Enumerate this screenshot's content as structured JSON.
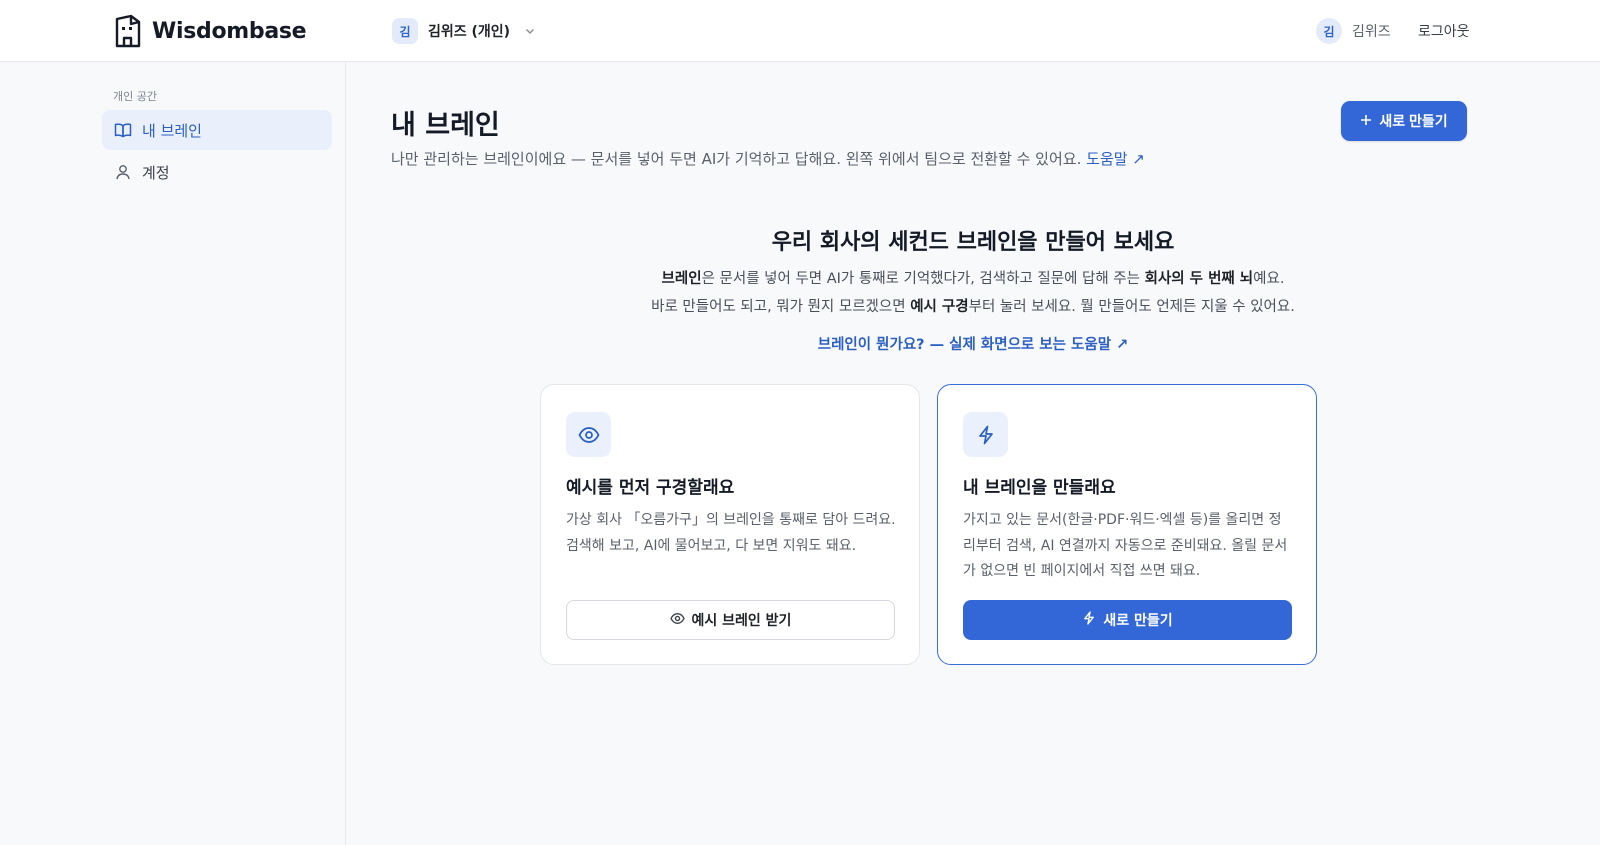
{
  "colors": {
    "accent": "#3366d6",
    "link": "#2b5fc4",
    "active_bg": "#e9effb",
    "page_bg": "#f8f9fb"
  },
  "header": {
    "logo_text": "Wisdombase",
    "logo_icon": "building-logo-icon",
    "workspace": {
      "avatar": "김",
      "name": "김위즈 (개인)",
      "chevron_icon": "chevron-down-icon"
    },
    "user": {
      "avatar": "김",
      "name": "김위즈"
    },
    "logout_label": "로그아웃"
  },
  "sidebar": {
    "section_label": "개인 공간",
    "items": [
      {
        "label": "내 브레인",
        "icon": "book-open-icon",
        "active": true
      },
      {
        "label": "계정",
        "icon": "user-icon",
        "active": false
      }
    ]
  },
  "main": {
    "title": "내 브레인",
    "subtitle": "나만 관리하는 브레인이에요 — 문서를 넣어 두면 AI가 기억하고 답해요. 왼쪽 위에서 팀으로 전환할 수 있어요.",
    "help_link": "도움말 ↗",
    "new_button_label": "새로 만들기",
    "new_button_icon": "plus-icon"
  },
  "hero": {
    "title": "우리 회사의 세컨드 브레인을 만들어 보세요",
    "line1": {
      "b1": "브레인",
      "t1": "은 문서를 넣어 두면 AI가 통째로 기억했다가, 검색하고 질문에 답해 주는 ",
      "b2": "회사의 두 번째 뇌",
      "t2": "예요."
    },
    "line2": {
      "t1": "바로 만들어도 되고, 뭐가 뭔지 모르겠으면 ",
      "b1": "예시 구경",
      "t2": "부터 눌러 보세요. 뭘 만들어도 언제든 지울 수 있어요."
    },
    "link": "브레인이 뭔가요? — 실제 화면으로 보는 도움말 ↗"
  },
  "cards": [
    {
      "icon": "eye-icon",
      "title": "예시를 먼저 구경할래요",
      "desc": "가상 회사 「오름가구」의 브레인을 통째로 담아 드려요. 검색해 보고, AI에 물어보고, 다 보면 지워도 돼요.",
      "button_label": "예시 브레인 받기",
      "button_icon": "eye-icon"
    },
    {
      "icon": "lightning-icon",
      "title": "내 브레인을 만들래요",
      "desc": "가지고 있는 문서(한글·PDF·워드·엑셀 등)를 올리면 정리부터 검색, AI 연결까지 자동으로 준비돼요. 올릴 문서가 없으면 빈 페이지에서 직접 쓰면 돼요.",
      "button_label": "새로 만들기",
      "button_icon": "lightning-icon"
    }
  ]
}
